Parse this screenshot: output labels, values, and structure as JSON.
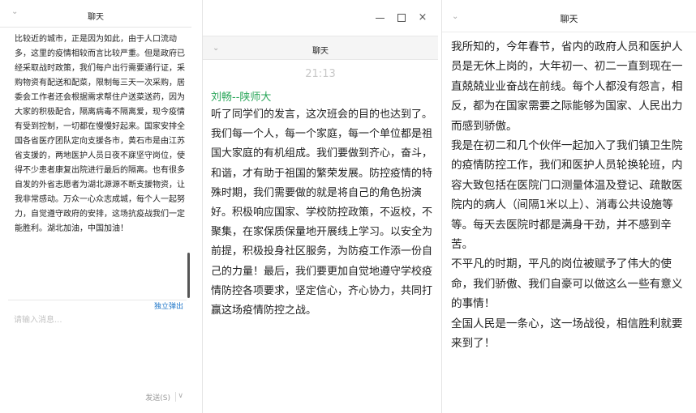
{
  "panel_left": {
    "header": {
      "title": "聊天",
      "chevron_icon": "chevron-down-icon"
    },
    "message": "比较近的城市，正是因为如此，由于人口流动多，这里的疫情相较而言比较严重。但是政府已经采取战时政策，我们每户出行需要通行证，采购物资有配送和配菜，限制每三天一次采购，居委会工作者还会根据需求帮住户送菜送药，因为大家的积极配合，隔离病毒不隔离爱，现今疫情有受到控制，一切都在慢慢好起来。国家安排全国各省医疗团队定向支援各市，黄石市是由江苏省支援的，两地医护人员日夜不寐坚守岗位，使得不少患者康复出院进行最后的隔离。也有很多自发的外省志愿者为湖北源源不断支援物资，让我非常感动。万众一心众志成城，每个人一起努力，自觉遵守政府的安排，这场抗疫战我们一定能胜利。湖北加油，中国加油！",
    "popout_label": "独立弹出",
    "input": {
      "placeholder": "请输入消息..."
    },
    "send_label": "发送(S)",
    "send_arrow": "∨"
  },
  "panel_middle": {
    "window_controls": {
      "minimize": "minimize-icon",
      "maximize": "maximize-icon",
      "close": "×"
    },
    "header": {
      "title": "聊天",
      "chevron_icon": "chevron-down-icon"
    },
    "time": "21:13",
    "sender": "刘畅--陕师大",
    "message": "听了同学们的发言，这次班会的目的也达到了。我们每一个人，每一个家庭，每一个单位都是祖国大家庭的有机组成。我们要做到齐心，奋斗，和谐，才有助于祖国的繁荣发展。防控疫情的特殊时期，我们需要做的就是将自己的角色扮演好。积极响应国家、学校防控政策，不返校，不聚集，在家保质保量地开展线上学习。以安全为前提，积极投身社区服务，为防疫工作添一份自己的力量！最后，我们要更加自觉地遵守学校疫情防控各项要求，坚定信心，齐心协力，共同打赢这场疫情防控之战。"
  },
  "panel_right": {
    "header": {
      "title": "聊天",
      "chevron_icon": "chevron-down-icon"
    },
    "paragraphs": [
      "我所知的，今年春节，省内的政府人员和医护人员是无休上岗的，大年初一、初二一直到现在一直兢兢业业奋战在前线。每个人都没有怨言，相反，都为在国家需要之际能够为国家、人民出力而感到骄傲。",
      "我是在初二和几个伙伴一起加入了我们镇卫生院的疫情防控工作，我们和医护人员轮换轮班，内容大致包括在医院门口测量体温及登记、疏散医院内的病人（间隔1米以上）、消毒公共设施等等。每天去医院时都是满身干劲，并不感到辛苦。",
      "不平凡的时期，平凡的岗位被赋予了伟大的使命，我们骄傲、我们自豪可以做这么一些有意义的事情！",
      "全国人民是一条心，这一场战役，相信胜利就要来到了！"
    ]
  }
}
